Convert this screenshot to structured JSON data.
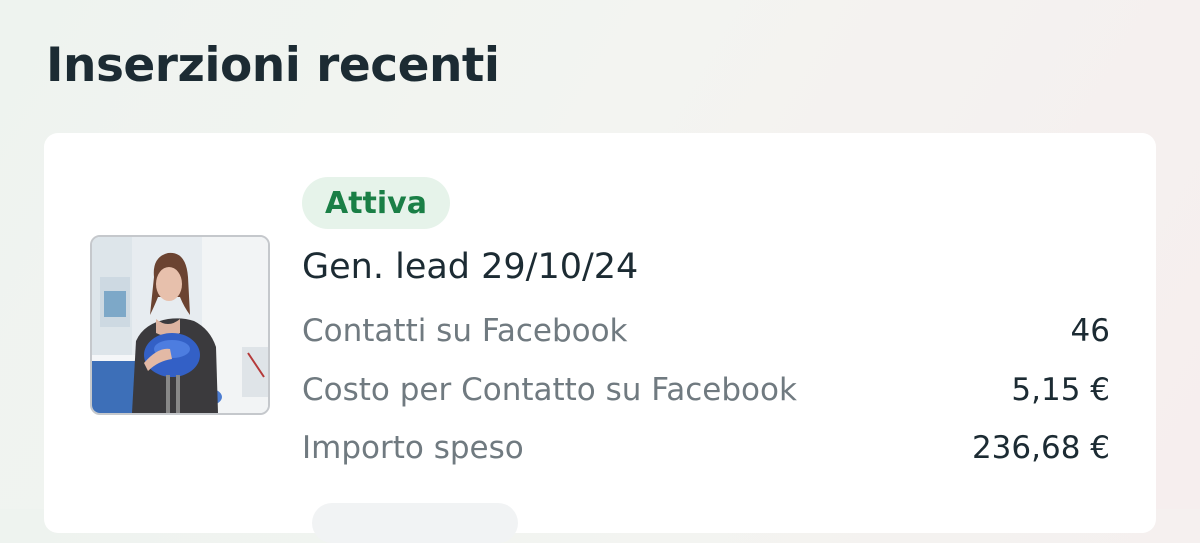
{
  "header": {
    "title": "Inserzioni recenti"
  },
  "ad": {
    "status": "Attiva",
    "name": "Gen. lead 29/10/24",
    "thumbnail": "woman-holding-blue-dental-model-thumbnail",
    "metrics": [
      {
        "label": "Contatti su Facebook",
        "value": "46"
      },
      {
        "label": "Costo per Contatto su Facebook",
        "value": "5,15 €"
      },
      {
        "label": "Importo speso",
        "value": "236,68 €"
      }
    ]
  },
  "colors": {
    "status_active": "#1a7f46",
    "status_active_bg": "#e6f3ea",
    "text_primary": "#1c2b33",
    "text_secondary": "#707a80"
  }
}
